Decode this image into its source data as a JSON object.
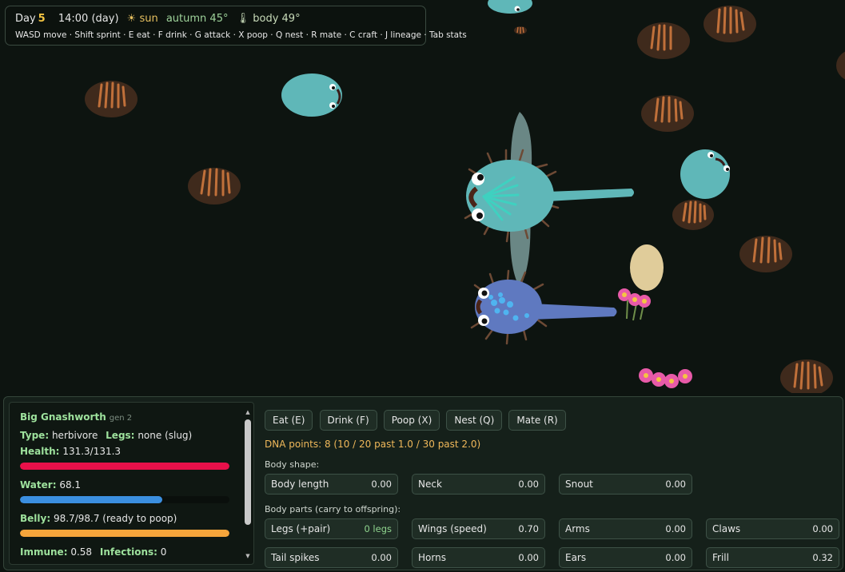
{
  "hud": {
    "day_label": "Day",
    "day_number": "5",
    "time": "14:00 (day)",
    "weather_icon": "sun-icon",
    "weather": "☀ sun",
    "season": "autumn 45°",
    "body_temp": "🌡 body 49°",
    "keys": "WASD move · Shift sprint · E eat · F drink · G attack · X poop · Q nest · R mate · C craft · J lineage · Tab stats"
  },
  "creature": {
    "name": "Big Gnashworth",
    "gen": "gen 2",
    "type_label": "Type:",
    "type": "herbivore",
    "legs_label": "Legs:",
    "legs": "none (slug)",
    "health_label": "Health:",
    "health": "131.3/131.3",
    "health_fraction": 1.0,
    "health_color": "#e8104a",
    "water_label": "Water:",
    "water": "68.1",
    "water_fraction": 0.681,
    "water_color": "#3b8fe0",
    "belly_label": "Belly:",
    "belly": "98.7/98.7 (ready to poop)",
    "belly_fraction": 1.0,
    "belly_color": "#f6a53b",
    "immune_label": "Immune:",
    "immune": "0.58",
    "infections_label": "Infections:",
    "infections": "0"
  },
  "actions": [
    "Eat (E)",
    "Drink (F)",
    "Poop (X)",
    "Nest (Q)",
    "Mate (R)"
  ],
  "dna_points": "DNA points: 8 (10 / 20 past 1.0 / 30 past 2.0)",
  "body_shape": {
    "title": "Body shape:",
    "traits": [
      {
        "name": "Body length",
        "value": "0.00"
      },
      {
        "name": "Neck",
        "value": "0.00"
      },
      {
        "name": "Snout",
        "value": "0.00"
      }
    ]
  },
  "body_parts": {
    "title": "Body parts (carry to offspring):",
    "traits": [
      {
        "name": "Legs (+pair)",
        "value": "0 legs"
      },
      {
        "name": "Wings (speed)",
        "value": "0.70"
      },
      {
        "name": "Arms",
        "value": "0.00"
      },
      {
        "name": "Claws",
        "value": "0.00"
      },
      {
        "name": "Tail spikes",
        "value": "0.00"
      },
      {
        "name": "Horns",
        "value": "0.00"
      },
      {
        "name": "Ears",
        "value": "0.00"
      },
      {
        "name": "Frill",
        "value": "0.32"
      }
    ]
  },
  "colors": {
    "background": "#0d1410",
    "nut": "#3f2a1c",
    "nut_stripe": "#c0703a",
    "creature_teal": "#5fb7b8",
    "creature_blue": "#5f79c0",
    "egg": "#e0cc9a",
    "flower": "#e85aa8"
  }
}
